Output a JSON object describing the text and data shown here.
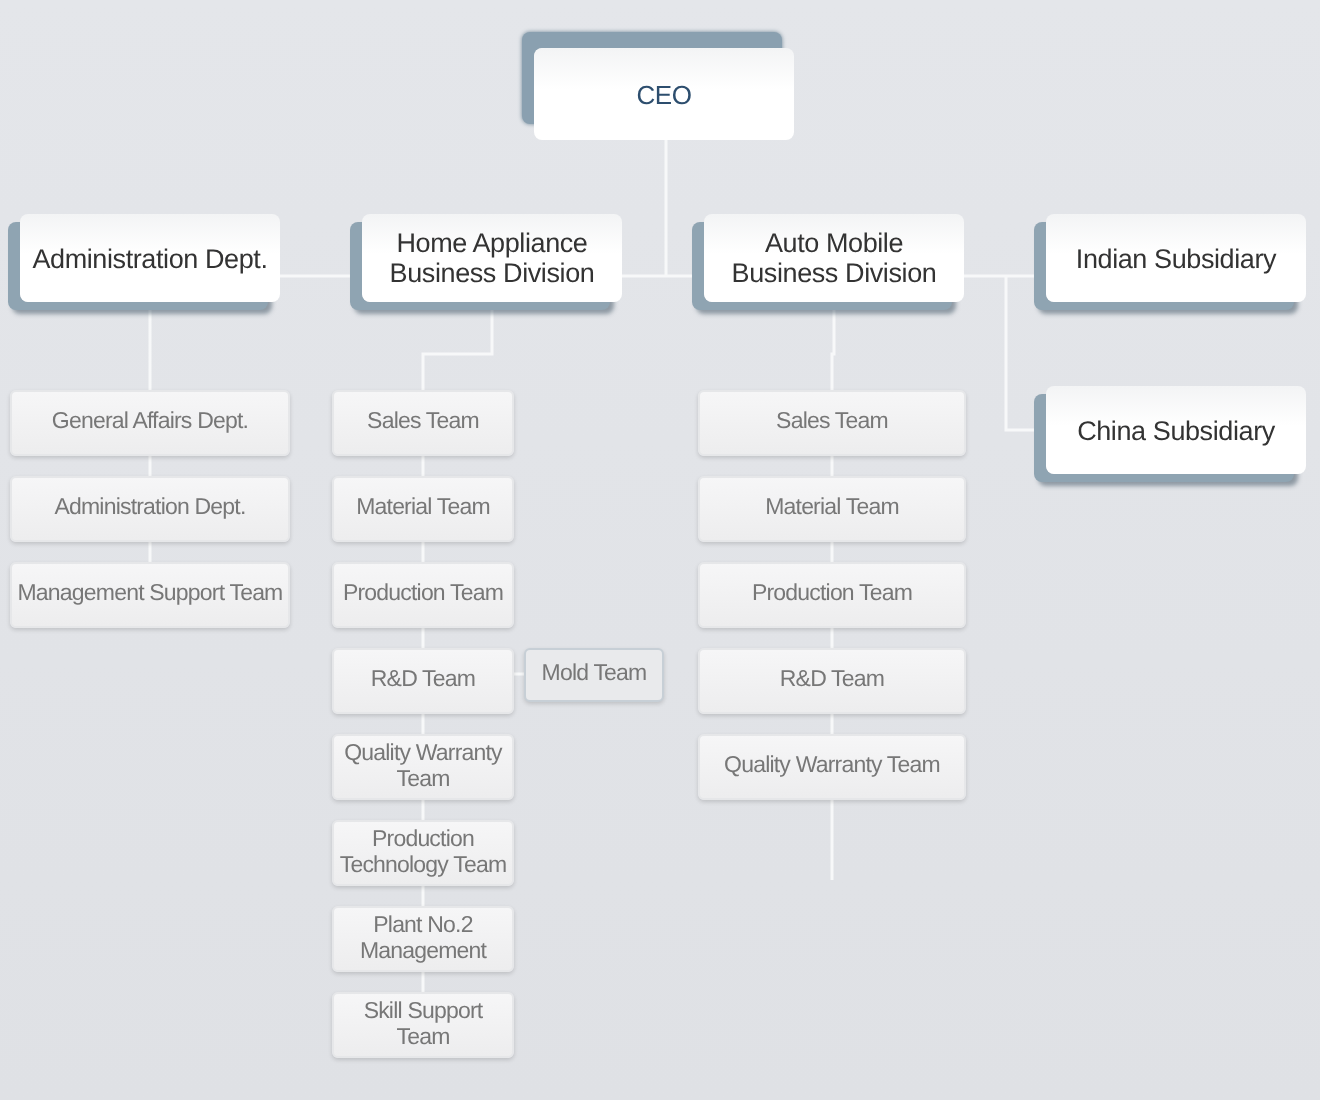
{
  "ceo": {
    "label": "CEO"
  },
  "divisions": [
    {
      "label": "Administration Dept.",
      "teams": [
        {
          "label": "General Affairs Dept."
        },
        {
          "label": "Administration Dept."
        },
        {
          "label": "Management Support Team"
        }
      ]
    },
    {
      "label": "Home Appliance Business Division",
      "teams": [
        {
          "label": "Sales Team"
        },
        {
          "label": "Material Team"
        },
        {
          "label": "Production Team"
        },
        {
          "label": "R&D Team",
          "children": [
            {
              "label": "Mold Team"
            }
          ]
        },
        {
          "label": "Quality Warranty Team"
        },
        {
          "label": "Production Technology Team"
        },
        {
          "label": "Plant No.2 Management"
        },
        {
          "label": "Skill Support Team"
        }
      ]
    },
    {
      "label": "Auto Mobile Business Division",
      "teams": [
        {
          "label": "Sales Team"
        },
        {
          "label": "Material Team"
        },
        {
          "label": "Production Team"
        },
        {
          "label": "R&D Team"
        },
        {
          "label": "Quality Warranty Team"
        }
      ]
    }
  ],
  "subsidiaries": [
    {
      "label": "Indian Subsidiary"
    },
    {
      "label": "China Subsidiary"
    }
  ]
}
